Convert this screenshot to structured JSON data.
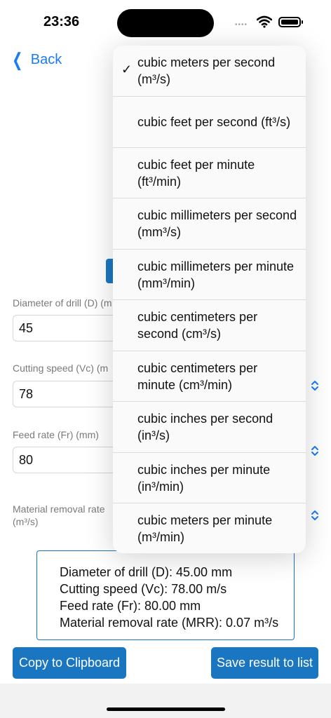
{
  "status_bar": {
    "time": "23:36",
    "signal_dots": "••••"
  },
  "nav": {
    "back_label": "Back"
  },
  "fields": [
    {
      "label": "Diameter of drill (D) (m",
      "value": "45"
    },
    {
      "label": "Cutting speed (Vc) (m",
      "value": "78"
    },
    {
      "label": "Feed rate (Fr) (mm)",
      "value": "80"
    }
  ],
  "mrr_label": [
    "Material removal rate",
    "(m³/s)"
  ],
  "result_lines": [
    "Diameter of drill (D): 45.00 mm",
    "Cutting speed (Vc): 78.00 m/s",
    "Feed rate (Fr): 80.00 mm",
    "Material removal rate (MRR): 0.07 m³/s"
  ],
  "buttons": {
    "copy": "Copy to Clipboard",
    "save": "Save result to list"
  },
  "unit_menu": {
    "selected_index": 0,
    "check_glyph": "✓",
    "options": [
      "cubic meters per second (m³/s)",
      "cubic feet per second (ft³/s)",
      "cubic feet per minute (ft³/min)",
      "cubic millimeters per second (mm³/s)",
      "cubic millimeters per minute (mm³/min)",
      "cubic centimeters per second (cm³/s)",
      "cubic centimeters per minute (cm³/min)",
      "cubic inches per second (in³/s)",
      "cubic inches per minute (in³/min)",
      "cubic meters per minute (m³/min)"
    ]
  },
  "colors": {
    "accent": "#1a7cf5",
    "button": "#1b76c2"
  }
}
